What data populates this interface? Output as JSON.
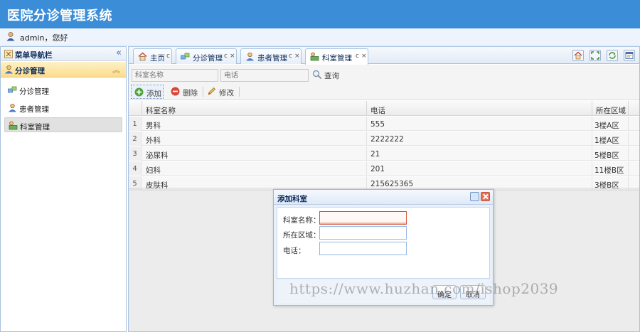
{
  "app": {
    "title": "医院分诊管理系统",
    "user_greeting": "admin，您好"
  },
  "sidebar": {
    "header": "菜单导航栏",
    "collapse_glyph": "«",
    "group": {
      "label": "分诊管理",
      "arrow": "︽"
    },
    "items": [
      {
        "label": "分诊管理",
        "icon": "link-icon"
      },
      {
        "label": "患者管理",
        "icon": "user-icon"
      },
      {
        "label": "科室管理",
        "icon": "department-icon",
        "active": true
      }
    ]
  },
  "tabs": [
    {
      "label": "主页",
      "icon": "home-icon",
      "refresh": "c",
      "close": ""
    },
    {
      "label": "分诊管理",
      "icon": "link-icon",
      "refresh": "c",
      "close": "×"
    },
    {
      "label": "患者管理",
      "icon": "user-icon",
      "refresh": "c",
      "close": "×"
    },
    {
      "label": "科室管理",
      "icon": "department-icon",
      "refresh": "c",
      "close": "×",
      "active": true
    }
  ],
  "tab_tools": [
    "home-icon",
    "fullscreen-icon",
    "refresh-icon",
    "window-icon"
  ],
  "search": {
    "name_placeholder": "科室名称",
    "phone_placeholder": "电话",
    "button_label": "查询"
  },
  "toolbar": {
    "add_label": "添加",
    "delete_label": "删除",
    "edit_label": "修改"
  },
  "table": {
    "columns": [
      "科室名称",
      "电话",
      "所在区域"
    ],
    "rows": [
      {
        "n": "1",
        "name": "男科",
        "phone": "555",
        "area": "3楼A区"
      },
      {
        "n": "2",
        "name": "外科",
        "phone": "2222222",
        "area": "1楼A区"
      },
      {
        "n": "3",
        "name": "泌尿科",
        "phone": "21",
        "area": "5楼B区"
      },
      {
        "n": "4",
        "name": "妇科",
        "phone": "201",
        "area": "11楼B区"
      },
      {
        "n": "5",
        "name": "皮肤科",
        "phone": "215625365",
        "area": "3楼B区"
      }
    ]
  },
  "dialog": {
    "title": "添加科室",
    "fields": [
      {
        "label": "科室名称：",
        "value": ""
      },
      {
        "label": "所在区域：",
        "value": ""
      },
      {
        "label": "电话：",
        "value": ""
      }
    ],
    "ok_label": "确定",
    "cancel_label": "取消"
  },
  "watermark": "https://www.huzhan.com/ishop2039",
  "colors": {
    "header_blue": "#3c8dd8",
    "group_gold": "#fbdd8e",
    "invalid_red": "#d05a3f"
  }
}
